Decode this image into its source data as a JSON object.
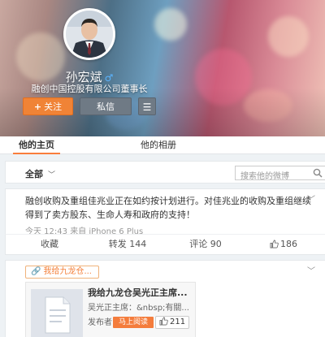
{
  "profile": {
    "name": "孙宏斌",
    "gender_icon": "male-icon",
    "description": "融创中国控股有限公司董事长",
    "follow_label": "关注",
    "message_label": "私信",
    "menu_icon": "hamburger-menu-icon"
  },
  "tabs": [
    {
      "label": "他的主页",
      "active": true
    },
    {
      "label": "他的相册",
      "active": false
    }
  ],
  "filter": {
    "all_label": "全部",
    "search_placeholder": "搜索他的微博"
  },
  "post1": {
    "text": "融创收购及重组佳兆业正在如约按计划进行。对佳兆业的收购及重组继续得到了卖方股东、生命人寿和政府的支持！",
    "time": "今天 12:43",
    "source": "来自 iPhone 6 Plus",
    "actions": {
      "collect": "收藏",
      "repost": "转发 144",
      "comment": "评论 90",
      "like": "186"
    }
  },
  "post2": {
    "tag": "我给九龙仓...",
    "link_title": "我给九龙仓吴光正主席...",
    "link_sub": "吴光正主席：&nbsp;有關...",
    "link_publisher": "发布者：孙宏斌",
    "read_label": "马上阅读",
    "like_count": "211"
  },
  "colors": {
    "accent": "#f08336",
    "tab_underline": "#fa7d3c",
    "read_button": "#f47c3c",
    "page_bg": "#eef2f5"
  }
}
